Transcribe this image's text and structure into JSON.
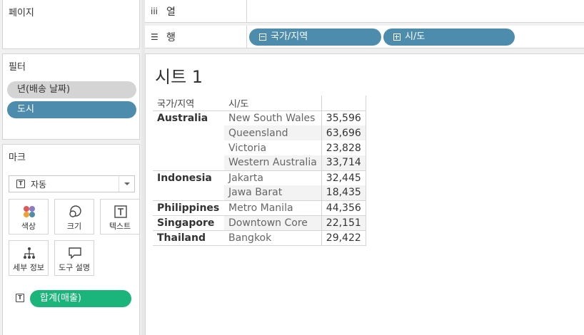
{
  "left_panel": {
    "pages": {
      "title": "페이지"
    },
    "filters": {
      "title": "필터",
      "items": [
        "년(배송 날짜)",
        "도시"
      ]
    },
    "marks": {
      "title": "마크",
      "type_select": "자동",
      "buttons": [
        {
          "label": "색상",
          "icon": "color-icon"
        },
        {
          "label": "크기",
          "icon": "size-icon"
        },
        {
          "label": "텍스트",
          "icon": "text-icon"
        },
        {
          "label": "세부 정보",
          "icon": "detail-icon"
        },
        {
          "label": "도구 설명",
          "icon": "tooltip-icon"
        }
      ],
      "fields": [
        {
          "label": "합계(매출)",
          "type_icon": "text-icon"
        }
      ]
    }
  },
  "shelves": {
    "columns": {
      "label": "열",
      "icon": "iii",
      "pills": []
    },
    "rows": {
      "label": "행",
      "icon": "☰",
      "pills": [
        "국가/지역",
        "시/도"
      ]
    }
  },
  "view": {
    "title": "시트 1",
    "headers": [
      "국가/지역",
      "시/도"
    ],
    "rows": [
      {
        "country": "Australia",
        "state": "New South Wales",
        "value": "35,596"
      },
      {
        "country": "",
        "state": "Queensland",
        "value": "63,696"
      },
      {
        "country": "",
        "state": "Victoria",
        "value": "23,828"
      },
      {
        "country": "",
        "state": "Western Australia",
        "value": "33,714"
      },
      {
        "country": "Indonesia",
        "state": "Jakarta",
        "value": "32,445"
      },
      {
        "country": "",
        "state": "Jawa Barat",
        "value": "18,435"
      },
      {
        "country": "Philippines",
        "state": "Metro Manila",
        "value": "44,356"
      },
      {
        "country": "Singapore",
        "state": "Downtown Core",
        "value": "22,151"
      },
      {
        "country": "Thailand",
        "state": "Bangkok",
        "value": "29,422"
      }
    ]
  },
  "colors": {
    "dimension_pill": "#4e8cae",
    "measure_pill": "#1bb47b",
    "filter_pill": "#d4d4d4"
  }
}
